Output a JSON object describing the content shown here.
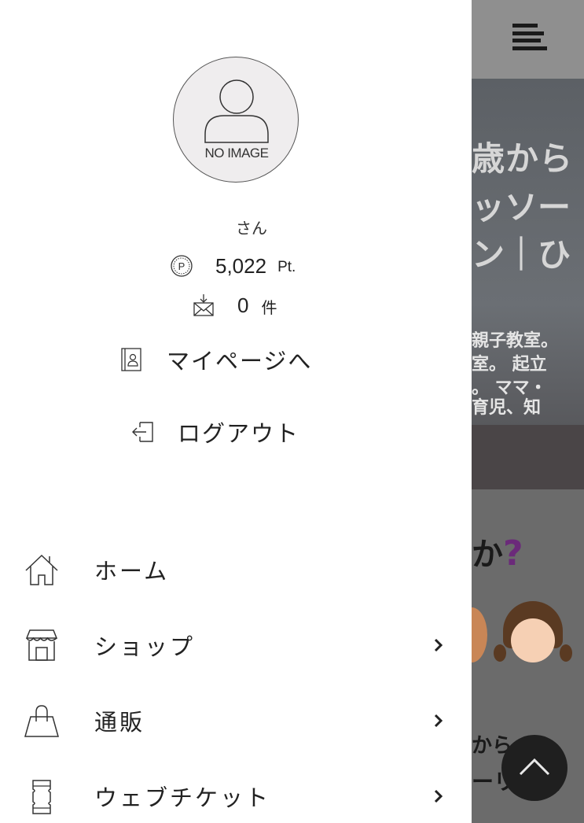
{
  "drawer": {
    "avatar_text": "NO IMAGE",
    "user_suffix": "さん",
    "points": {
      "value": "5,022",
      "unit": "Pt."
    },
    "messages": {
      "value": "0",
      "unit": "件"
    },
    "mypage_label": "マイページへ",
    "logout_label": "ログアウト",
    "nav": [
      {
        "label": "ホーム",
        "icon": "home-icon",
        "has_submenu": false
      },
      {
        "label": "ショップ",
        "icon": "shop-icon",
        "has_submenu": true
      },
      {
        "label": "通販",
        "icon": "shopping-bag-icon",
        "has_submenu": true
      },
      {
        "label": "ウェブチケット",
        "icon": "ticket-icon",
        "has_submenu": true
      }
    ]
  },
  "background": {
    "hero_lines": [
      "歳から",
      "ッソー",
      "ン｜ひ",
      "親子教室。",
      "室。 起立",
      "。 ママ・",
      "育児、知"
    ],
    "section_question": "か",
    "section_question_mark": "?",
    "section_text_1": "から",
    "section_text_2": "ーリ植型"
  },
  "colors": {
    "overlay_gray": "#8f8f8f",
    "text_dark": "#222222",
    "accent_purple": "#6b2a7a",
    "scroll_button": "#1f1f1f"
  }
}
